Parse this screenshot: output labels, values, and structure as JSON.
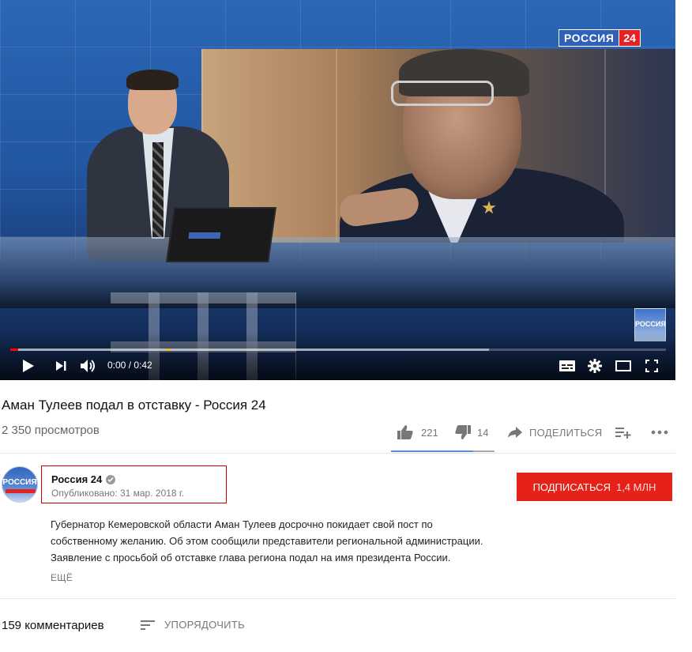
{
  "player": {
    "channel_logo_name": "РОССИЯ",
    "channel_logo_num": "24",
    "corner_logo": "РОССИЯ",
    "laptop_logo": "РОССИЯ 24",
    "time": "0:00 / 0:42",
    "progress": {
      "played_fraction": 0.012,
      "loaded_fraction": 0.73
    },
    "icons": [
      "play-icon",
      "next-icon",
      "volume-icon",
      "subtitles-icon",
      "settings-icon",
      "theater-mode-icon",
      "fullscreen-icon"
    ]
  },
  "video": {
    "title": "Аман Тулеев подал в отставку - Россия 24",
    "views": "2 350 просмотров",
    "likes": "221",
    "dislikes": "14",
    "share_label": "ПОДЕЛИТЬСЯ"
  },
  "channel": {
    "avatar_text": "РОССИЯ",
    "name": "Россия 24",
    "published": "Опубликовано: 31 мар. 2018 г.",
    "subscribe_label": "ПОДПИСАТЬСЯ",
    "subscriber_count": "1,4 МЛН"
  },
  "description": {
    "lines": [
      "Губернатор Кемеровской области Аман Тулеев досрочно покидает свой пост по",
      "собственному желанию. Об этом сообщили представители региональной администрации.",
      "Заявление с просьбой об отставке глава региона подал на имя президента России."
    ],
    "more_label": "ЕЩЁ"
  },
  "comments": {
    "count_label": "159 комментариев",
    "sort_label": "УПОРЯДОЧИТЬ"
  },
  "colors": {
    "subscribe_red": "#e62117",
    "progress_red": "#ff0000",
    "like_blue": "#5d8fd6"
  }
}
